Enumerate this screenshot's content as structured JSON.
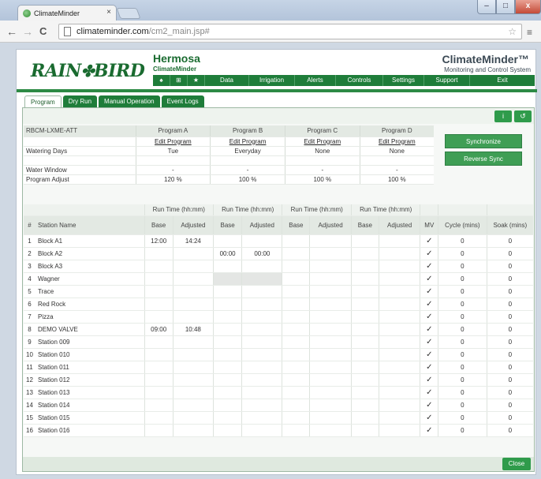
{
  "browser": {
    "tab_title": "ClimateMinder",
    "tab_close": "×",
    "url_host": "climateminder.com",
    "url_path": "/cm2_main.jsp#",
    "back": "←",
    "forward": "→",
    "reload": "C",
    "bookmark": "☆",
    "menu": "≡",
    "win_min": "–",
    "win_max": "□",
    "win_close": "x"
  },
  "header": {
    "logo_left": "RAIN",
    "logo_mark": "✤",
    "logo_right": "BIRD",
    "site_name": "Hermosa",
    "site_sub": "ClimateMinder",
    "brand_title": "ClimateMinder™",
    "brand_sub": "Monitoring and Control System",
    "nav": [
      "♠",
      "⊞",
      "★",
      "Data",
      "Irrigation",
      "Alerts",
      "Controls",
      "Settings",
      "Support",
      "Exit"
    ]
  },
  "tabs": [
    "Program",
    "Dry Run",
    "Manual Operation",
    "Event Logs"
  ],
  "toolbar": {
    "info": "i",
    "refresh": "↺"
  },
  "programs": {
    "controller": "RBCM-LXME-ATT",
    "names": [
      "Program A",
      "Program B",
      "Program C",
      "Program D"
    ],
    "edit_label": "Edit Program",
    "row_labels": {
      "watering_days": "Watering Days",
      "water_window": "Water Window",
      "program_adjust": "Program Adjust"
    },
    "watering_days": [
      "Tue",
      "Everyday",
      "None",
      "None"
    ],
    "water_window": [
      "-",
      "-",
      "-",
      "-"
    ],
    "program_adjust": [
      "120 %",
      "100 %",
      "100 %",
      "100 %"
    ]
  },
  "sync": {
    "synchronize": "Synchronize",
    "reverse": "Reverse Sync"
  },
  "stations": {
    "group_header": "Run Time (hh:mm)",
    "headers": {
      "num": "#",
      "name": "Station Name",
      "base": "Base",
      "adjusted": "Adjusted",
      "mv": "MV",
      "cycle": "Cycle (mins)",
      "soak": "Soak (mins)"
    },
    "rows": [
      {
        "n": "1",
        "name": "Block A1",
        "a_base": "12:00",
        "a_adj": "14:24",
        "b_base": "",
        "b_adj": "",
        "mv": "✓",
        "cycle": "0",
        "soak": "0"
      },
      {
        "n": "2",
        "name": "Block A2",
        "a_base": "",
        "a_adj": "",
        "b_base": "00:00",
        "b_adj": "00:00",
        "mv": "✓",
        "cycle": "0",
        "soak": "0"
      },
      {
        "n": "3",
        "name": "Block A3",
        "a_base": "",
        "a_adj": "",
        "b_base": "",
        "b_adj": "",
        "mv": "✓",
        "cycle": "0",
        "soak": "0"
      },
      {
        "n": "4",
        "name": "Wagner",
        "a_base": "",
        "a_adj": "",
        "b_base": "",
        "b_adj": "",
        "mv": "✓",
        "cycle": "0",
        "soak": "0"
      },
      {
        "n": "5",
        "name": "Trace",
        "a_base": "",
        "a_adj": "",
        "b_base": "",
        "b_adj": "",
        "mv": "✓",
        "cycle": "0",
        "soak": "0"
      },
      {
        "n": "6",
        "name": "Red Rock",
        "a_base": "",
        "a_adj": "",
        "b_base": "",
        "b_adj": "",
        "mv": "✓",
        "cycle": "0",
        "soak": "0"
      },
      {
        "n": "7",
        "name": "Pizza",
        "a_base": "",
        "a_adj": "",
        "b_base": "",
        "b_adj": "",
        "mv": "✓",
        "cycle": "0",
        "soak": "0"
      },
      {
        "n": "8",
        "name": "DEMO VALVE",
        "a_base": "09:00",
        "a_adj": "10:48",
        "b_base": "",
        "b_adj": "",
        "mv": "✓",
        "cycle": "0",
        "soak": "0"
      },
      {
        "n": "9",
        "name": "Station 009",
        "a_base": "",
        "a_adj": "",
        "b_base": "",
        "b_adj": "",
        "mv": "✓",
        "cycle": "0",
        "soak": "0"
      },
      {
        "n": "10",
        "name": "Station 010",
        "a_base": "",
        "a_adj": "",
        "b_base": "",
        "b_adj": "",
        "mv": "✓",
        "cycle": "0",
        "soak": "0"
      },
      {
        "n": "11",
        "name": "Station 011",
        "a_base": "",
        "a_adj": "",
        "b_base": "",
        "b_adj": "",
        "mv": "✓",
        "cycle": "0",
        "soak": "0"
      },
      {
        "n": "12",
        "name": "Station 012",
        "a_base": "",
        "a_adj": "",
        "b_base": "",
        "b_adj": "",
        "mv": "✓",
        "cycle": "0",
        "soak": "0"
      },
      {
        "n": "13",
        "name": "Station 013",
        "a_base": "",
        "a_adj": "",
        "b_base": "",
        "b_adj": "",
        "mv": "✓",
        "cycle": "0",
        "soak": "0"
      },
      {
        "n": "14",
        "name": "Station 014",
        "a_base": "",
        "a_adj": "",
        "b_base": "",
        "b_adj": "",
        "mv": "✓",
        "cycle": "0",
        "soak": "0"
      },
      {
        "n": "15",
        "name": "Station 015",
        "a_base": "",
        "a_adj": "",
        "b_base": "",
        "b_adj": "",
        "mv": "✓",
        "cycle": "0",
        "soak": "0"
      },
      {
        "n": "16",
        "name": "Station 016",
        "a_base": "",
        "a_adj": "",
        "b_base": "",
        "b_adj": "",
        "mv": "✓",
        "cycle": "0",
        "soak": "0"
      }
    ]
  },
  "footer": {
    "close": "Close"
  },
  "colors": {
    "brand_green": "#1f7d3a",
    "button_green": "#2f9b4b",
    "header_slate": "#3c4a55"
  }
}
